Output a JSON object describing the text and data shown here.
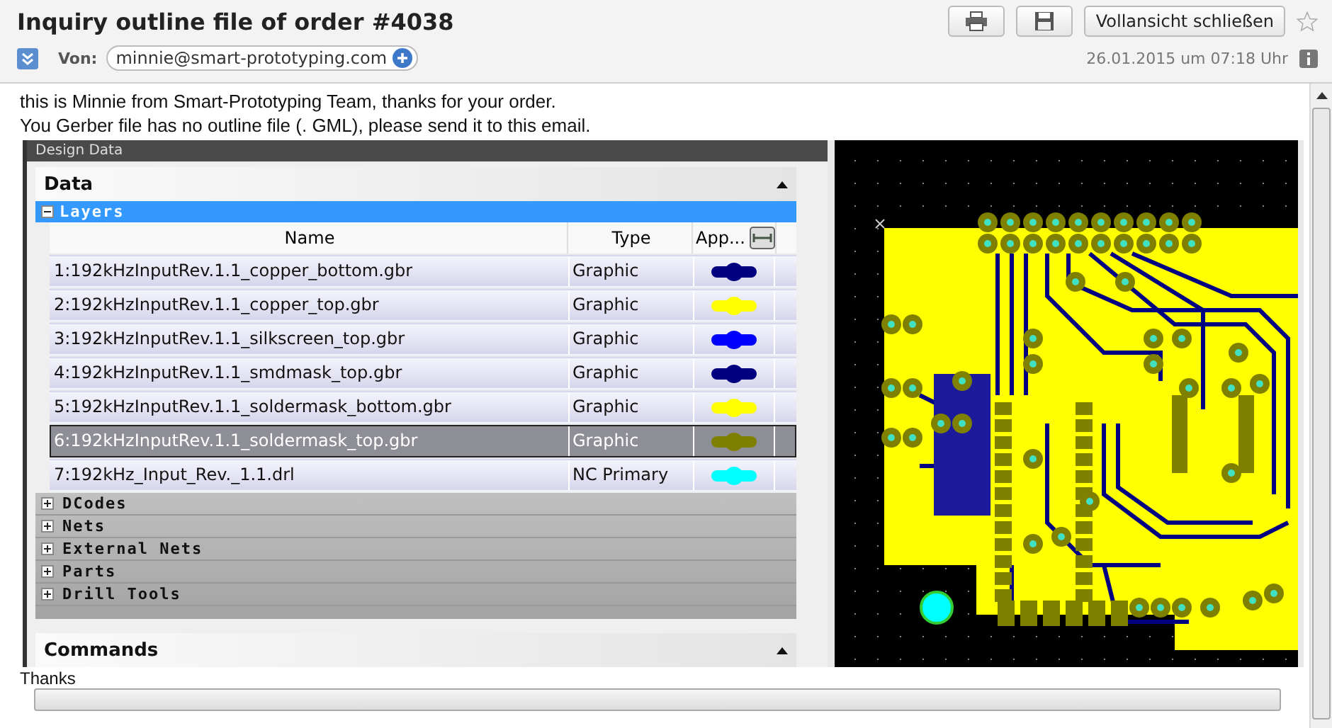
{
  "message": {
    "subject": "Inquiry outline file of order #4038",
    "close_full_view": "Vollansicht schließen",
    "starred": false,
    "from_label": "Von:",
    "from_address": "minnie@smart-prototyping.com",
    "date": "26.01.2015 um 07:18 Uhr",
    "body_lines": [
      "this is Minnie from Smart-Prototyping Team, thanks for your order.",
      "You Gerber file has no outline file (. GML), please send it to this email."
    ],
    "closing": "Thanks"
  },
  "design_data": {
    "title": "Design Data",
    "panel_title": "Data",
    "layers": {
      "label": "Layers",
      "expanded": true,
      "columns": [
        "Name",
        "Type",
        "App..."
      ],
      "rows": [
        {
          "name": "1:192kHzInputRev.1.1_copper_bottom.gbr",
          "type": "Graphic",
          "color": "#000080",
          "selected": false
        },
        {
          "name": "2:192kHzInputRev.1.1_copper_top.gbr",
          "type": "Graphic",
          "color": "#ffff00",
          "selected": false
        },
        {
          "name": "3:192kHzInputRev.1.1_silkscreen_top.gbr",
          "type": "Graphic",
          "color": "#0000ff",
          "selected": false
        },
        {
          "name": "4:192kHzInputRev.1.1_smdmask_top.gbr",
          "type": "Graphic",
          "color": "#000080",
          "selected": false
        },
        {
          "name": "5:192kHzInputRev.1.1_soldermask_bottom.gbr",
          "type": "Graphic",
          "color": "#ffff00",
          "selected": false
        },
        {
          "name": "6:192kHzInputRev.1.1_soldermask_top.gbr",
          "type": "Graphic",
          "color": "#808000",
          "selected": true
        },
        {
          "name": "7:192kHz_Input_Rev._1.1.drl",
          "type": "NC Primary",
          "color": "#00ffff",
          "selected": false
        }
      ]
    },
    "sections": [
      {
        "label": "DCodes",
        "expanded": false
      },
      {
        "label": "Nets",
        "expanded": false
      },
      {
        "label": "External Nets",
        "expanded": false
      },
      {
        "label": "Parts",
        "expanded": false
      },
      {
        "label": "Drill Tools",
        "expanded": false
      }
    ],
    "commands_title": "Commands"
  }
}
